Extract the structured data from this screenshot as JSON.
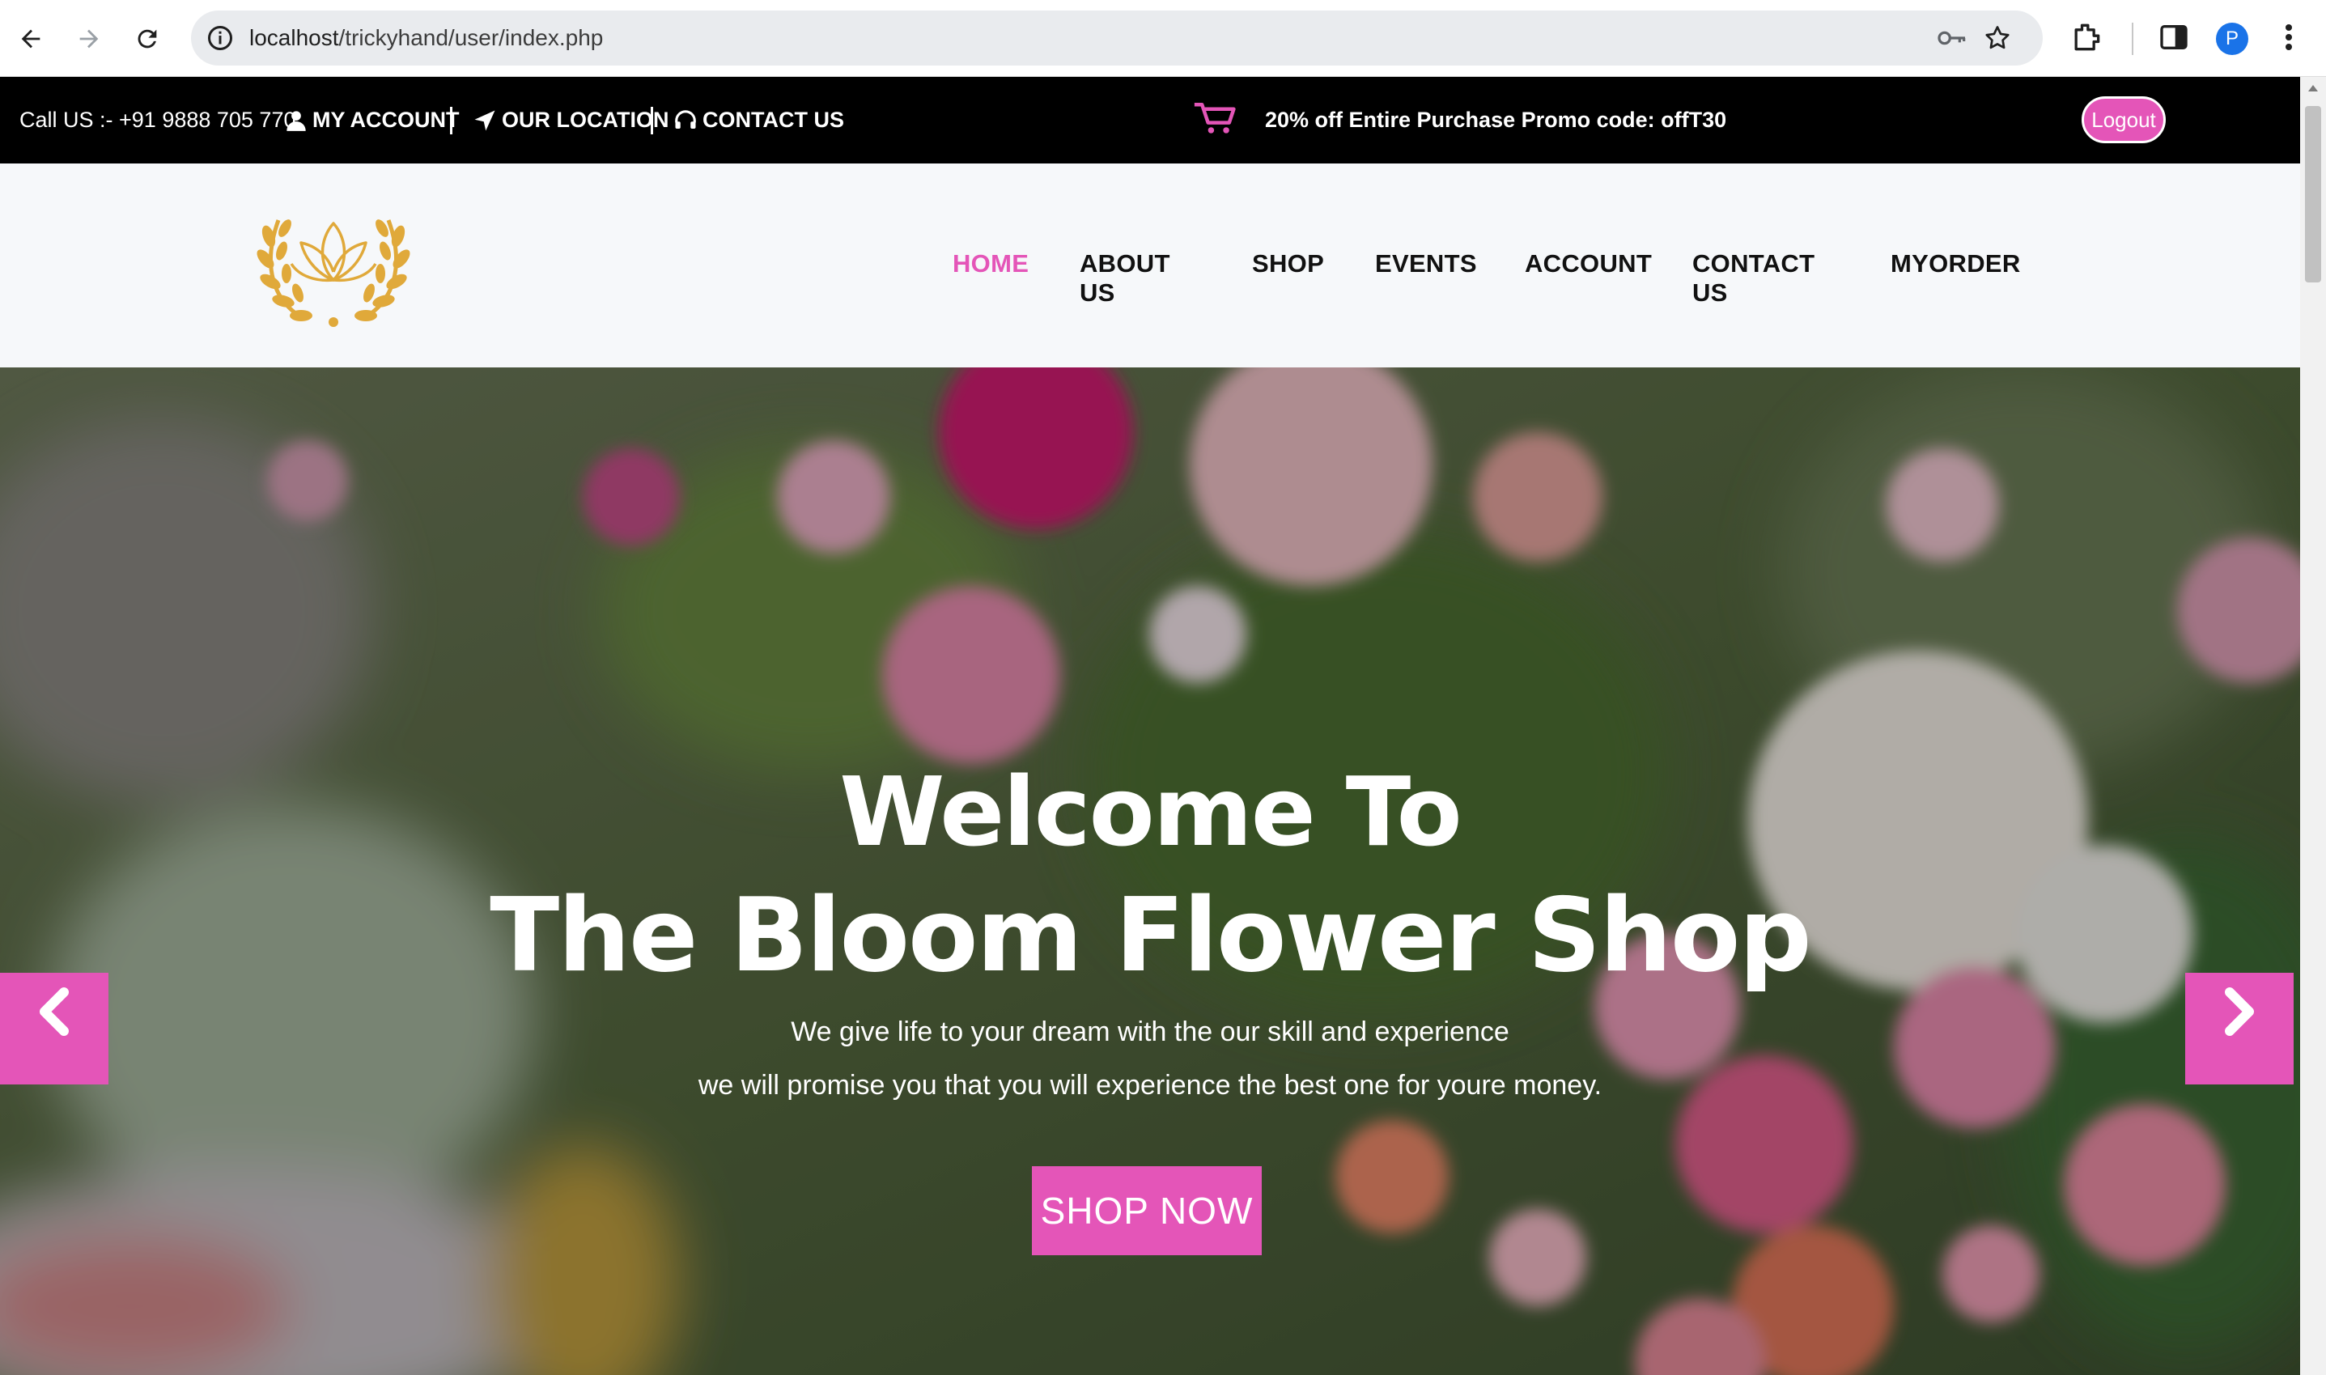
{
  "browser": {
    "url_host": "localhost",
    "url_path": "/trickyhand/user/index.php",
    "avatar_letter": "P"
  },
  "topbar": {
    "call": "Call US :- +91 9888 705 770",
    "my_account": "MY ACCOUNT",
    "our_location": "OUR LOCATION",
    "contact_us": "CONTACT US",
    "promo": "20% off Entire Purchase Promo code: offT30",
    "logout": "Logout"
  },
  "nav": {
    "items": [
      "HOME",
      "ABOUT US",
      "SHOP",
      "EVENTS",
      "ACCOUNT",
      "CONTACT US",
      "MYORDER"
    ],
    "active_index": 0
  },
  "hero": {
    "title_line1": "Welcome To",
    "title_line2": "The Bloom Flower Shop",
    "subtitle_line1": "We give life to your dream with the our skill and experience",
    "subtitle_line2": "we will promise you that you will experience the best one for youre money.",
    "cta": "SHOP NOW"
  },
  "colors": {
    "accent": "#e455b8",
    "topbar_bg": "#000000",
    "header_bg": "#f6f8fa",
    "logo_gold": "#e0a93a"
  },
  "icons": [
    "back-icon",
    "forward-icon",
    "reload-icon",
    "info-icon",
    "key-icon",
    "star-icon",
    "extensions-icon",
    "side-panel-icon",
    "more-icon",
    "user-icon",
    "location-arrow-icon",
    "headset-icon",
    "cart-icon",
    "chevron-left-icon",
    "chevron-right-icon"
  ]
}
